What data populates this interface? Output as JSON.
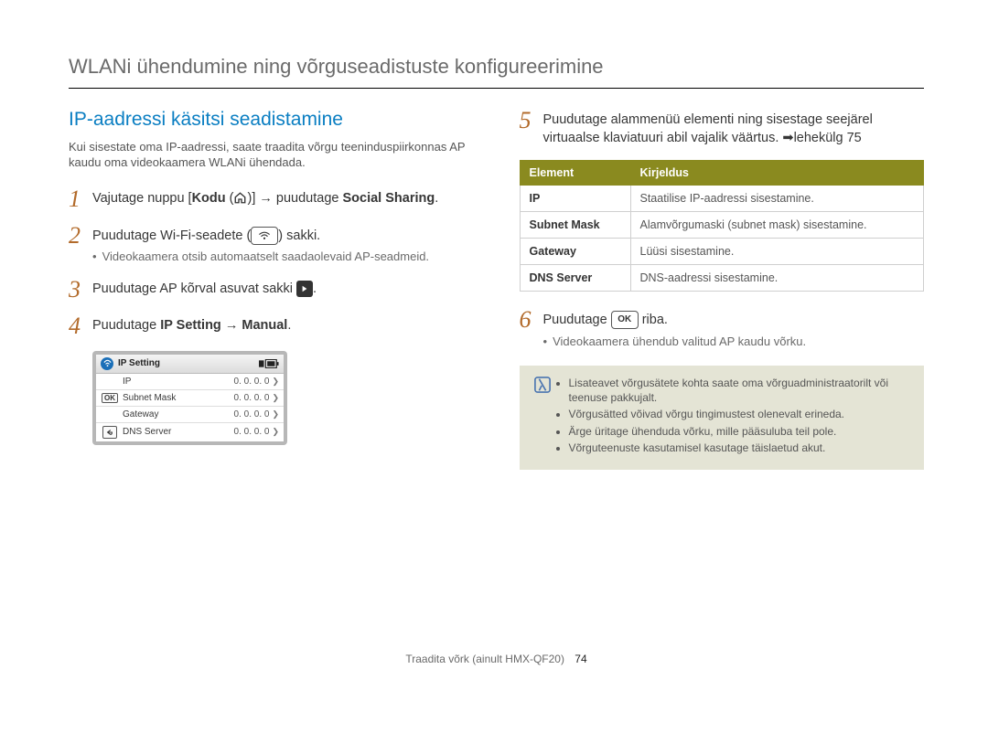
{
  "header": {
    "title": "WLANi ühendumine ning võrguseadistuste konfigureerimine"
  },
  "left": {
    "section_title": "IP-aadressi käsitsi seadistamine",
    "intro": "Kui sisestate oma IP-aadressi, saate traadita võrgu teeninduspiirkonnas AP kaudu oma videokaamera WLANi ühendada.",
    "step1": {
      "pre": "Vajutage nuppu [",
      "kodu": "Kodu",
      "mid": " (",
      "post": ")] → puudutage ",
      "social": "Social Sharing",
      "end": "."
    },
    "step2": {
      "text_pre": "Puudutage Wi-Fi-seadete (",
      "text_post": ") sakki.",
      "sub": "Videokaamera otsib automaatselt saadaolevaid AP-seadmeid."
    },
    "step3": {
      "text_pre": "Puudutage AP kõrval asuvat sakki ",
      "text_post": "."
    },
    "step4": {
      "text_pre": "Puudutage ",
      "bold1": "IP Setting",
      "arrow": " → ",
      "bold2": "Manual",
      "text_post": "."
    },
    "device": {
      "title": "IP Setting",
      "rows": [
        {
          "label": "IP",
          "value": "0. 0. 0. 0"
        },
        {
          "label": "Subnet Mask",
          "value": "0. 0. 0. 0"
        },
        {
          "label": "Gateway",
          "value": "0. 0. 0. 0"
        },
        {
          "label": "DNS Server",
          "value": "0. 0. 0. 0"
        }
      ]
    }
  },
  "right": {
    "step5": {
      "line1": "Puudutage alammenüü elementi ning sisestage seejärel virtuaalse klaviatuuri abil vajalik väärtus. ➡lehekülg 75"
    },
    "table": {
      "head_element": "Element",
      "head_desc": "Kirjeldus",
      "rows": [
        {
          "key": "IP",
          "desc": "Staatilise IP-aadressi sisestamine."
        },
        {
          "key": "Subnet Mask",
          "desc": "Alamvõrgumaski (subnet mask) sisestamine."
        },
        {
          "key": "Gateway",
          "desc": "Lüüsi sisestamine."
        },
        {
          "key": "DNS Server",
          "desc": "DNS-aadressi sisestamine."
        }
      ]
    },
    "step6": {
      "text_pre": "Puudutage ",
      "text_post": " riba.",
      "sub": "Videokaamera ühendub valitud AP kaudu võrku."
    },
    "notes": [
      "Lisateavet võrgusätete kohta saate oma võrguadministraatorilt või teenuse pakkujalt.",
      "Võrgusätted võivad võrgu tingimustest olenevalt erineda.",
      "Ärge üritage ühenduda võrku, mille pääsuluba teil pole.",
      "Võrguteenuste kasutamisel kasutage täislaetud akut."
    ]
  },
  "footer": {
    "text": "Traadita võrk (ainult HMX-QF20)",
    "page": "74"
  }
}
